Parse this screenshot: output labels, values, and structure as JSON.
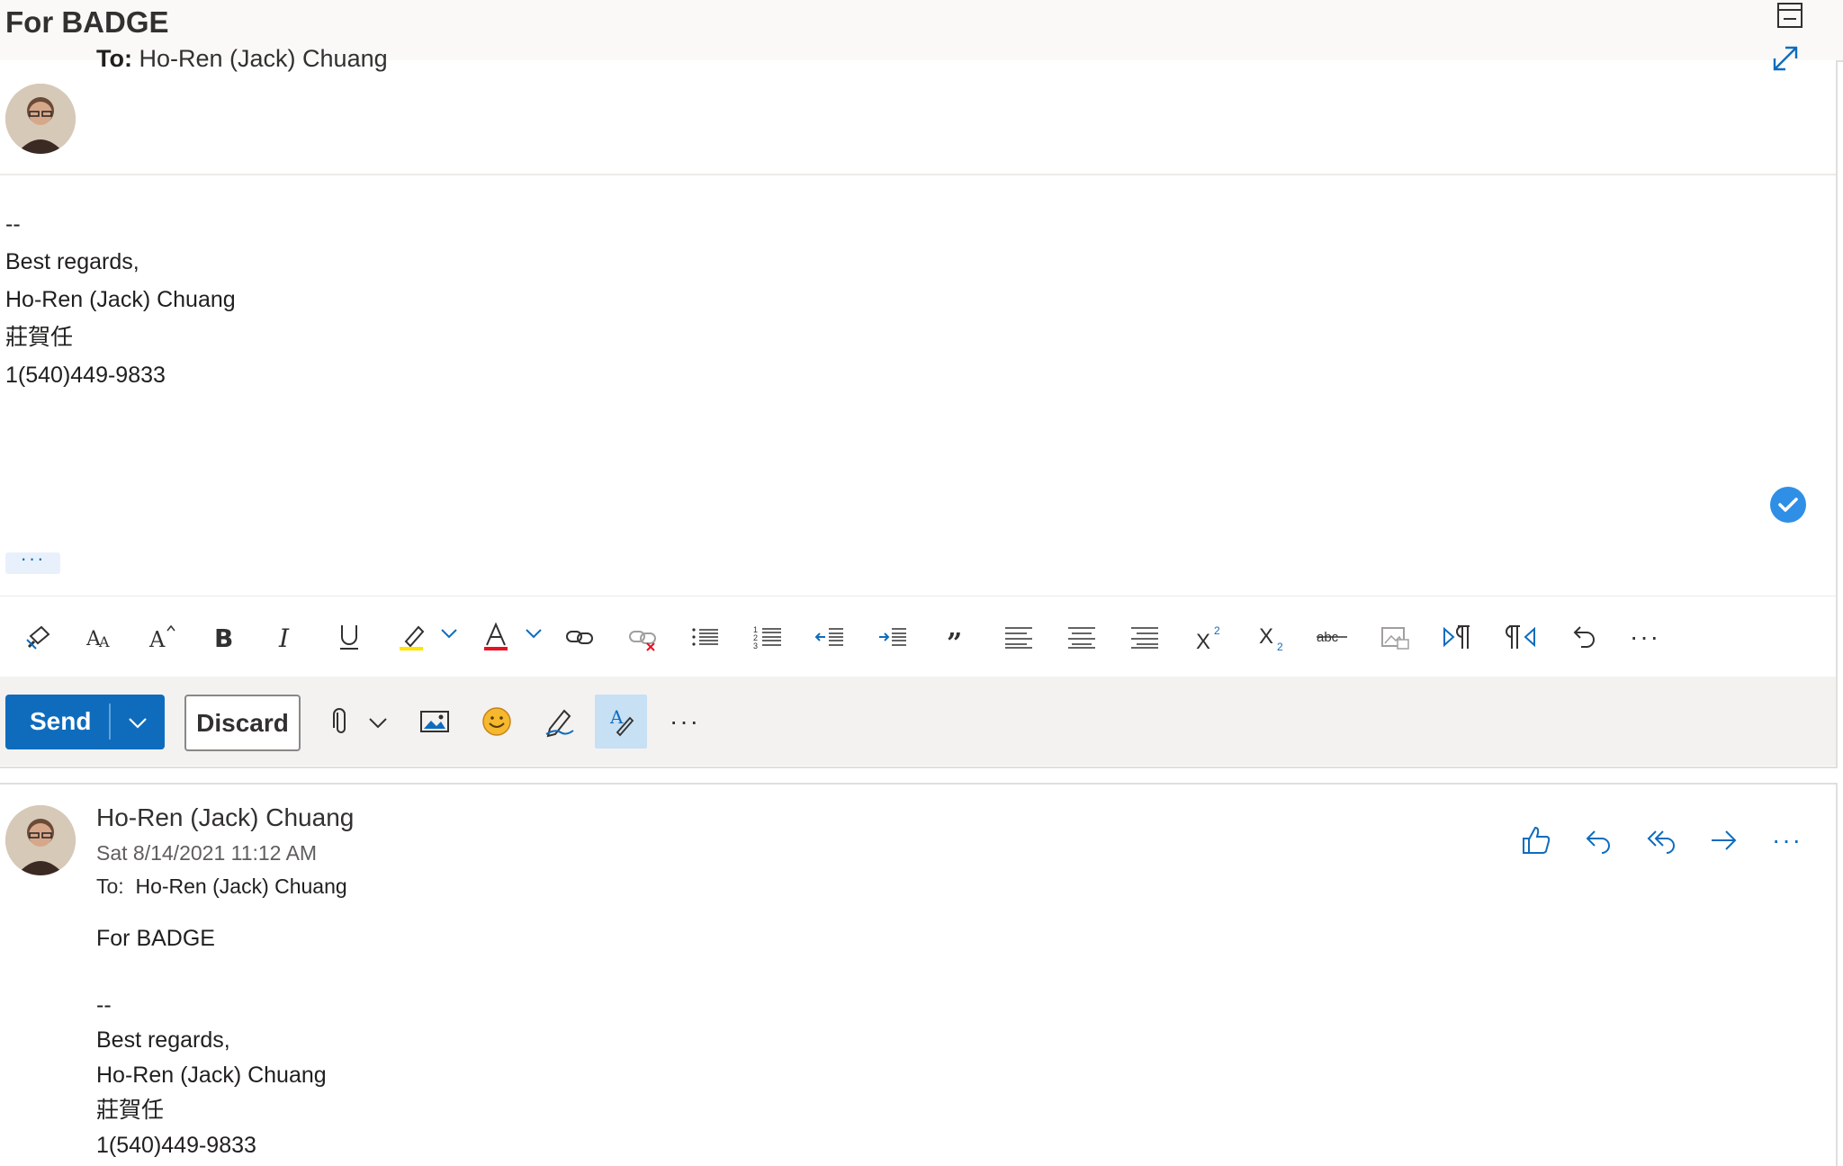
{
  "conversation": {
    "title": "For BADGE"
  },
  "compose": {
    "to_label": "To:",
    "to_value": "Ho-Ren (Jack) Chuang",
    "signature": {
      "separator": "--",
      "closing": "Best regards,",
      "name": "Ho-Ren (Jack) Chuang",
      "chinese_name": "莊賀任",
      "phone": "1(540)449-9833"
    },
    "show_more": "···"
  },
  "actions": {
    "send_label": "Send",
    "discard_label": "Discard",
    "more": "···"
  },
  "toolbar": {
    "more": "···"
  },
  "message": {
    "sender": "Ho-Ren (Jack) Chuang",
    "date": "Sat 8/14/2021 11:12 AM",
    "to_label": "To:",
    "to_value": "Ho-Ren (Jack) Chuang",
    "subject_line": "For BADGE",
    "signature": {
      "separator": "--",
      "closing": "Best regards,",
      "name": "Ho-Ren (Jack) Chuang",
      "chinese_name": "莊賀任",
      "phone": "1(540)449-9833"
    },
    "more": "···"
  },
  "colors": {
    "accent": "#0f6cbd",
    "check": "#2f8fe6",
    "highlight": "#ffe500",
    "font_color": "#e81123"
  }
}
